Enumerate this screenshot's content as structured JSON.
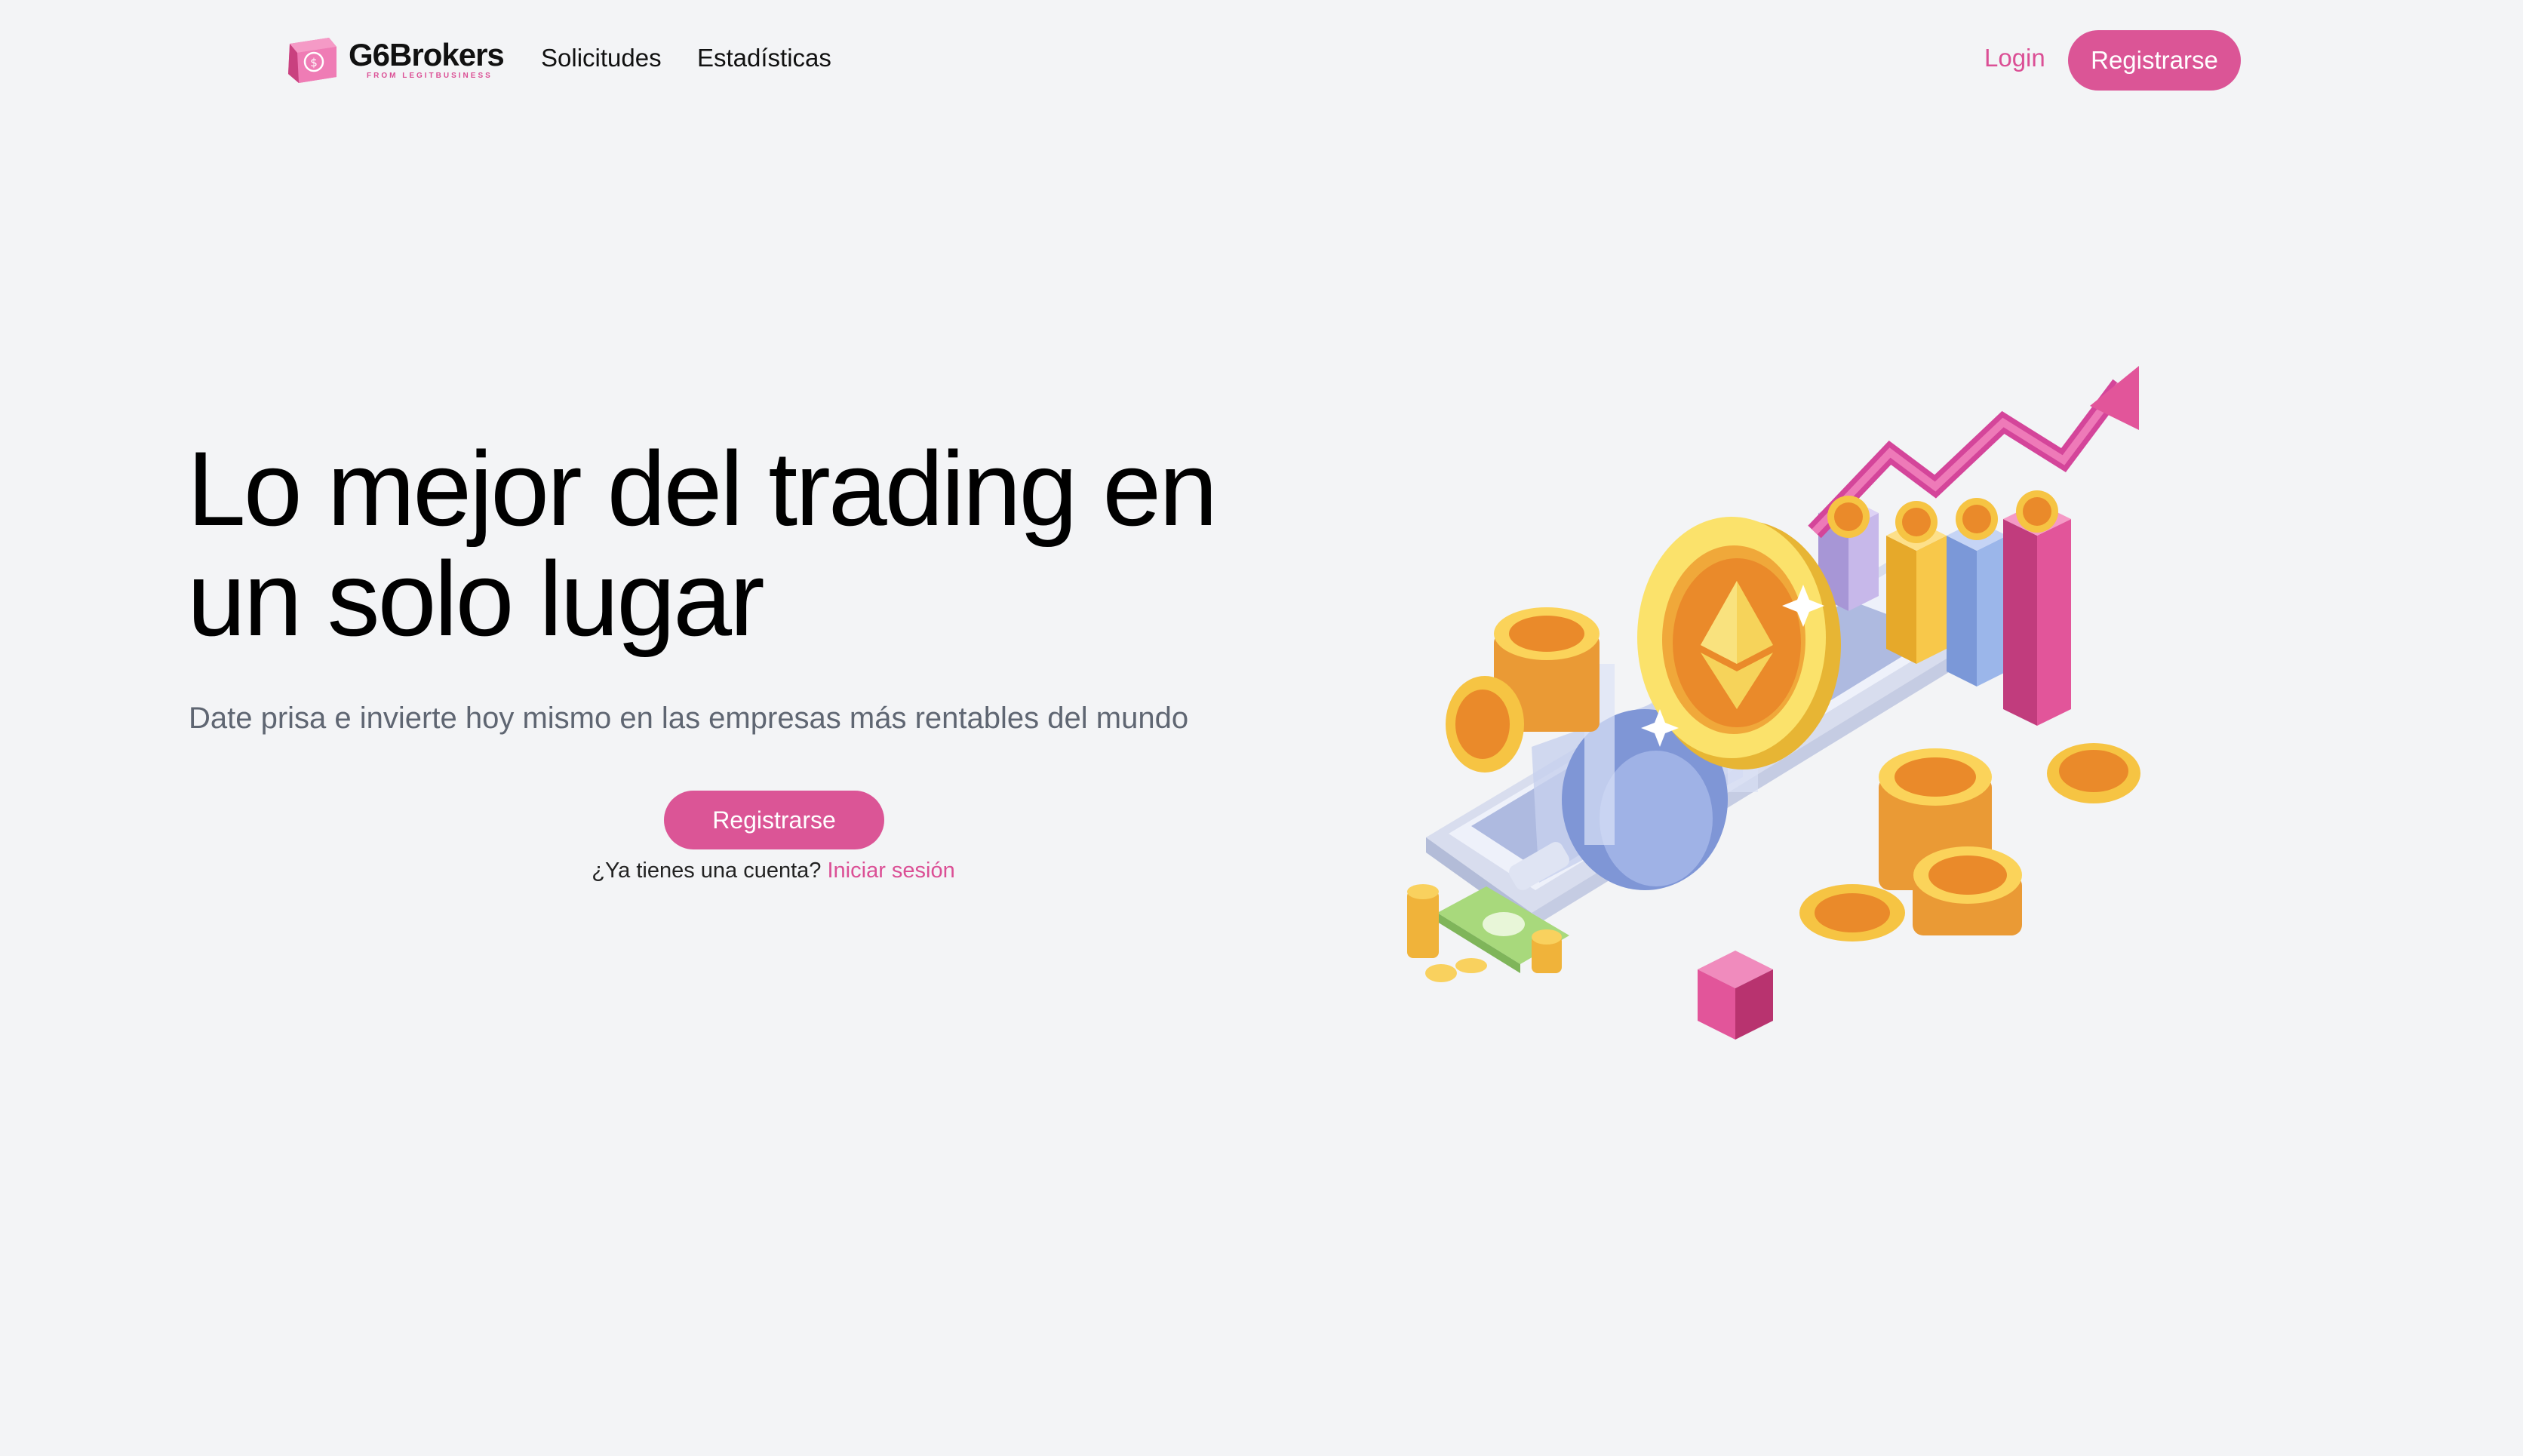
{
  "brand": {
    "name": "G6Brokers",
    "tagline": "FROM LEGITBUSINESS"
  },
  "nav": {
    "links": [
      {
        "label": "Solicitudes"
      },
      {
        "label": "Estadísticas"
      }
    ],
    "login_label": "Login",
    "register_label": "Registrarse"
  },
  "hero": {
    "title_line1": "Lo mejor del trading en",
    "title_line2": "un solo lugar",
    "subtitle": "Date prisa e invierte hoy mismo en las empresas más rentables del mundo",
    "cta_label": "Registrarse",
    "account_prompt": "¿Ya tienes una cuenta?",
    "account_link": "Iniciar sesión"
  },
  "colors": {
    "accent": "#db5596",
    "background": "#f3f4f6",
    "text": "#000000",
    "muted": "#5f6672"
  },
  "illustration": {
    "subject": "crypto-trading-phone-illustration"
  }
}
